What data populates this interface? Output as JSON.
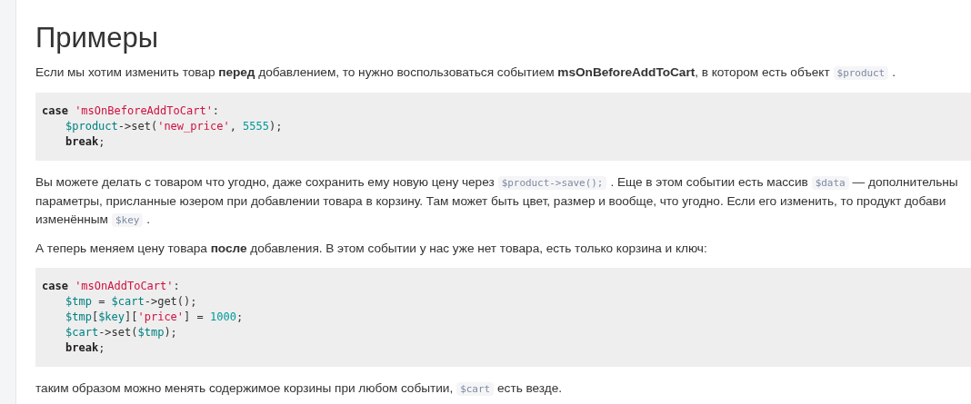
{
  "heading": "Примеры",
  "blocks": [
    {
      "kind": "paragraph",
      "lines": [
        [
          {
            "kind": "text",
            "text": "Если мы хотим изменить товар **перед** добавлением, то нужно воспользоваться событием **msOnBeforeAddToCart**, в котором есть объект"
          },
          {
            "kind": "code",
            "text": "$product"
          },
          {
            "kind": "text",
            "text": "."
          }
        ]
      ]
    },
    {
      "kind": "code",
      "head": [
        {
          "kind": "keyword",
          "text": "case"
        },
        {
          "kind": "string",
          "text": "'msOnBeforeAddToCart'"
        },
        {
          "kind": "plain",
          "text": ":"
        }
      ],
      "body": [
        [
          {
            "kind": "variable",
            "text": "$product"
          },
          {
            "kind": "plain",
            "text": "->set("
          },
          {
            "kind": "string",
            "text": "'new_price'"
          },
          {
            "kind": "plain",
            "text": ", "
          },
          {
            "kind": "number",
            "text": "5555"
          },
          {
            "kind": "plain",
            "text": ");"
          }
        ],
        [
          {
            "kind": "keyword",
            "text": "break"
          },
          {
            "kind": "plain",
            "text": ";"
          }
        ]
      ]
    },
    {
      "kind": "paragraph",
      "lines": [
        [
          {
            "kind": "text",
            "text": "Вы можете делать с товаром что угодно, даже сохранить ему новую цену через"
          },
          {
            "kind": "code",
            "text": "$product->save();"
          },
          {
            "kind": "text",
            "text": ". Еще в этом событии есть массив"
          },
          {
            "kind": "code",
            "text": "$data"
          },
          {
            "kind": "text",
            "text": "— дополнительны"
          }
        ],
        [
          {
            "kind": "text",
            "text": "параметры, присланные юзером при добавлении товара в корзину. Там может быть цвет, размер и вообще, что угодно. Если его изменить, то продукт добави"
          }
        ],
        [
          {
            "kind": "text",
            "text": "изменённым"
          },
          {
            "kind": "code",
            "text": "$key"
          },
          {
            "kind": "text",
            "text": "."
          }
        ]
      ]
    },
    {
      "kind": "paragraph",
      "lines": [
        [
          {
            "kind": "text",
            "text": "А теперь меняем цену товара **после** добавления. В этом событии у нас уже нет товара, есть только корзина и ключ:"
          }
        ]
      ]
    },
    {
      "kind": "code",
      "head": [
        {
          "kind": "keyword",
          "text": "case"
        },
        {
          "kind": "string",
          "text": "'msOnAddToCart'"
        },
        {
          "kind": "plain",
          "text": ":"
        }
      ],
      "body": [
        [
          {
            "kind": "variable",
            "text": "$tmp"
          },
          {
            "kind": "plain",
            "text": " = "
          },
          {
            "kind": "variable",
            "text": "$cart"
          },
          {
            "kind": "plain",
            "text": "->get();"
          }
        ],
        [
          {
            "kind": "variable",
            "text": "$tmp"
          },
          {
            "kind": "plain",
            "text": "["
          },
          {
            "kind": "variable",
            "text": "$key"
          },
          {
            "kind": "plain",
            "text": "]["
          },
          {
            "kind": "string",
            "text": "'price'"
          },
          {
            "kind": "plain",
            "text": "] = "
          },
          {
            "kind": "number",
            "text": "1000"
          },
          {
            "kind": "plain",
            "text": ";"
          }
        ],
        [
          {
            "kind": "variable",
            "text": "$cart"
          },
          {
            "kind": "plain",
            "text": "->set("
          },
          {
            "kind": "variable",
            "text": "$tmp"
          },
          {
            "kind": "plain",
            "text": ");"
          }
        ],
        [
          {
            "kind": "keyword",
            "text": "break"
          },
          {
            "kind": "plain",
            "text": ";"
          }
        ]
      ]
    },
    {
      "kind": "paragraph",
      "lines": [
        [
          {
            "kind": "text",
            "text": "таким образом можно менять содержимое корзины при любом событии,"
          },
          {
            "kind": "code",
            "text": "$cart"
          },
          {
            "kind": "text",
            "text": "есть везде."
          }
        ]
      ]
    }
  ]
}
